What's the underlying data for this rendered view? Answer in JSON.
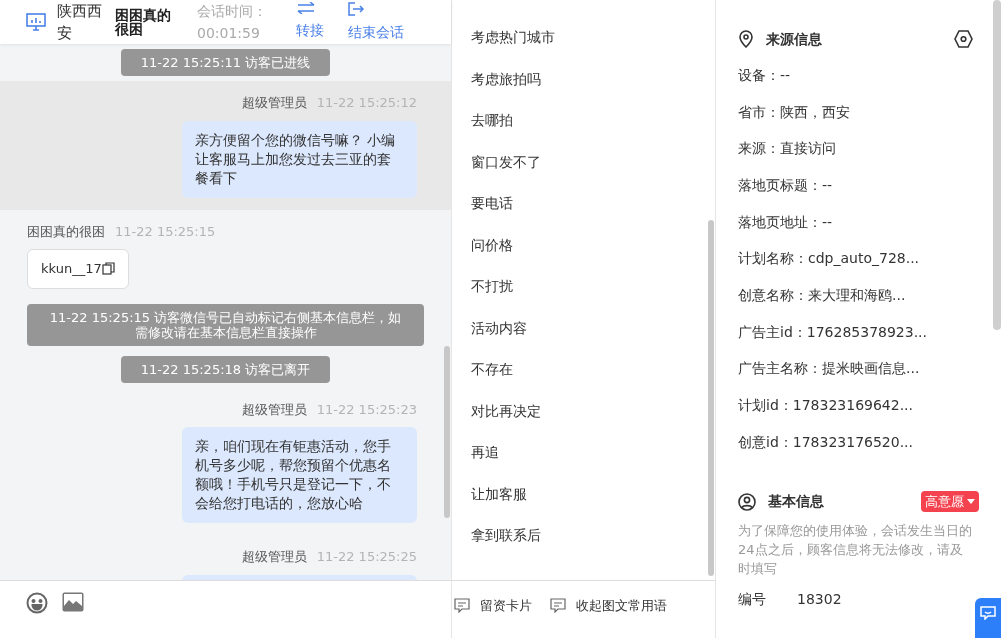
{
  "header": {
    "location": "陕西西安",
    "visitor": "困困真的很困",
    "session_label": "会话时间：",
    "session_time": "00:01:59",
    "actions": [
      {
        "kind": "transfer",
        "label": "转接"
      },
      {
        "kind": "end",
        "label": "结束会话"
      }
    ]
  },
  "messages": [
    {
      "kind": "system",
      "text": "11-22 15:25:11 访客已进线"
    },
    {
      "kind": "agent",
      "sender": "超级管理员",
      "time": "11-22 15:25:12",
      "text": "亲方便留个您的微信号嘛？ 小编让客服马上加您发过去三亚的套餐看下",
      "highlighted": true
    },
    {
      "kind": "visitor",
      "sender": "困困真的很困",
      "time": "11-22 15:25:15",
      "text": "kkun__17"
    },
    {
      "kind": "system",
      "text": "11-22 15:25:15 访客微信号已自动标记右侧基本信息栏，如需修改请在基本信息栏直接操作"
    },
    {
      "kind": "system",
      "text": "11-22 15:25:18 访客已离开"
    },
    {
      "kind": "agent",
      "sender": "超级管理员",
      "time": "11-22 15:25:23",
      "text": "亲，咱们现在有钜惠活动，您手机号多少呢，帮您预留个优惠名额哦！手机号只是登记一下，不会给您打电话的，您放心哈",
      "highlighted": false
    },
    {
      "kind": "agent",
      "sender": "超级管理员",
      "time": "11-22 15:25:25",
      "highlighted": false
    }
  ],
  "phrases": [
    "考虑热门城市",
    "考虑旅拍吗",
    "去哪拍",
    "窗口发不了",
    "要电话",
    "问价格",
    "不打扰",
    "活动内容",
    "不存在",
    "对比再决定",
    "再追",
    "让加客服",
    "拿到联系后"
  ],
  "toolbar": [
    "留资卡片",
    "收起图文常用语"
  ],
  "source_info": {
    "title": "来源信息",
    "fields": [
      "设备：--",
      "省市：陕西，西安",
      "来源：直接访问",
      "落地页标题：--",
      "落地页地址：--",
      "计划名称：cdp_auto_728...",
      "创意名称：来大理和海鸥...",
      "广告主id：176285378923...",
      "广告主名称：提米映画信息...",
      "计划id：178323169642...",
      "创意id：178323176520..."
    ]
  },
  "basic_info": {
    "title": "基本信息",
    "tag": "高意愿",
    "notice": "为了保障您的使用体验，会话发生当日的24点之后，顾客信息将无法修改，请及时填写",
    "fields": [
      {
        "label": "编号",
        "value": "18302"
      }
    ]
  }
}
